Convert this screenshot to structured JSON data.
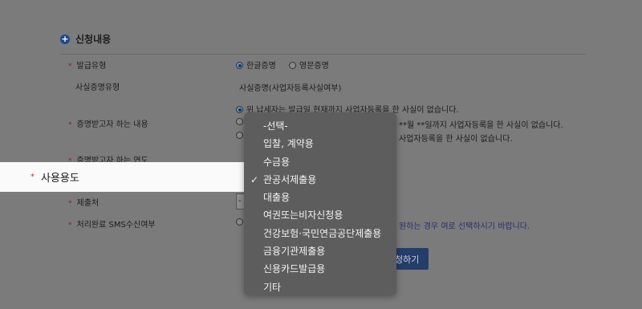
{
  "section": {
    "title": "신청내용"
  },
  "rows": {
    "issue_type": {
      "label": "발급유형",
      "options": [
        "한글증명",
        "영문증명"
      ]
    },
    "cert_type": {
      "label": "사실증명유형",
      "value": "사실증명(사업자등록사실여부)"
    },
    "content": {
      "label": "증명받고자 하는 내용",
      "options": [
        "위 납세자는 발급일 현재까지 사업자등록을 한 사실이 없습니다.",
        "**월 **일까지 사업자등록을 한 사실이 없습니다.",
        "사업자등록을 한 사실이 없습니다."
      ]
    },
    "year": {
      "label": "증명받고자 하는 연도"
    },
    "purpose": {
      "label": "사용용도"
    },
    "submit_to": {
      "label": "제출처",
      "select_value": "-"
    },
    "sms": {
      "label": "처리완료 SMS수신여부",
      "hint": "원하는 경우 여로 선택하시기 바랍니다."
    }
  },
  "apply_button": {
    "label": "청하기"
  },
  "dropdown": {
    "options": [
      "-선택-",
      "입찰, 계약용",
      "수금용",
      "관공서제출용",
      "대출용",
      "여권또는비자신청용",
      "건강보험·국민연금공단제출용",
      "금융기관제출용",
      "신용카드발급용",
      "기타"
    ],
    "selected_index": 3
  }
}
